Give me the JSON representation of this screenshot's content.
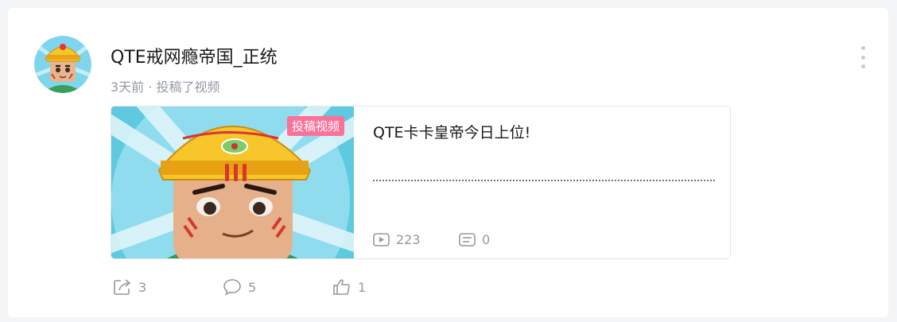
{
  "post": {
    "author_name": "QTE戒网瘾帝国_正统",
    "meta": "3天前 · 投稿了视频",
    "avatar_icon": "emperor-avatar-icon"
  },
  "video": {
    "badge": "投稿视频",
    "title": "QTE卡卡皇帝今日上位!",
    "description": "..........................................................................................",
    "plays": "223",
    "comments": "0"
  },
  "actions": {
    "share_count": "3",
    "comment_count": "5",
    "like_count": "1"
  },
  "colors": {
    "badge": "#fb7299",
    "muted": "#9499a0",
    "text": "#18191c"
  }
}
